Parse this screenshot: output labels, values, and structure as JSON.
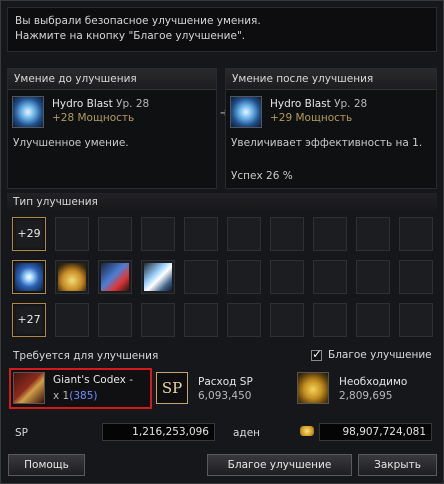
{
  "message": {
    "line1": "Вы выбрали безопасное улучшение умения.",
    "line2": "Нажмите на кнопку \"Благое улучшение\"."
  },
  "before": {
    "header": "Умение до улучшения",
    "skill_name": "Hydro Blast",
    "level": "Ур. 28",
    "bonus": "+28 Мощность",
    "description": "Улучшенное умение."
  },
  "after": {
    "header": "Умение после улучшения",
    "skill_name": "Hydro Blast",
    "level": "Ур. 28",
    "bonus": "+29 Мощность",
    "description": "Увеличивает эффективность на 1.",
    "success": "Успех 26 %"
  },
  "upgrade_type": {
    "header": "Тип улучшения",
    "top_value": "+29",
    "bottom_value": "+27",
    "middle_icons": [
      "star-skill-icon",
      "potion-skill-icon",
      "lightning-skill-icon",
      "blade-skill-icon"
    ]
  },
  "requirements": {
    "header": "Требуется для улучшения",
    "checkbox_label": "Благое улучшение",
    "checkbox_checked": true,
    "item": {
      "name": "Giant's Codex -",
      "qty_prefix": "x 1",
      "qty_owned": "(385)"
    },
    "sp": {
      "icon_text": "SP",
      "label": "Расход SP",
      "value": "6,093,450"
    },
    "adena": {
      "label": "Необходимо",
      "value": "2,809,695"
    }
  },
  "stats": {
    "sp_label": "SP",
    "sp_value": "1,216,253,096",
    "adena_label": "аден",
    "adena_value": "98,907,724,081"
  },
  "buttons": {
    "help": "Помощь",
    "blessed_upgrade": "Благое улучшение",
    "close": "Закрыть"
  },
  "colors": {
    "bonus": "#b49a5e",
    "highlight_border": "#d31b1b",
    "owned_count": "#6f8dff"
  }
}
